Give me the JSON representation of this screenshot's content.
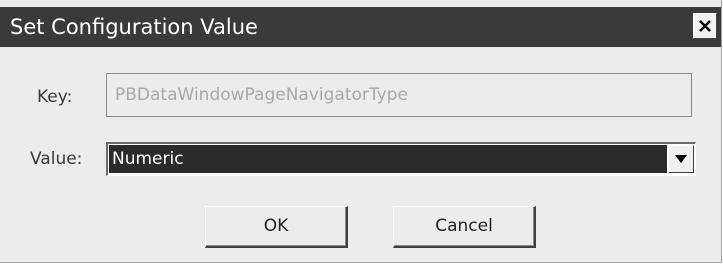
{
  "window": {
    "title": "Set Configuration Value"
  },
  "form": {
    "key_label": "Key:",
    "key_value": "PBDataWindowPageNavigatorType",
    "value_label": "Value:",
    "value_selected": "Numeric"
  },
  "buttons": {
    "ok_label": "OK",
    "cancel_label": "Cancel"
  },
  "icons": {
    "close": "close-icon",
    "dropdown": "chevron-down-icon"
  },
  "colors": {
    "titlebar": "#3a3a3a",
    "selection": "#2b2b2b",
    "dialog_bg": "#ececec"
  }
}
